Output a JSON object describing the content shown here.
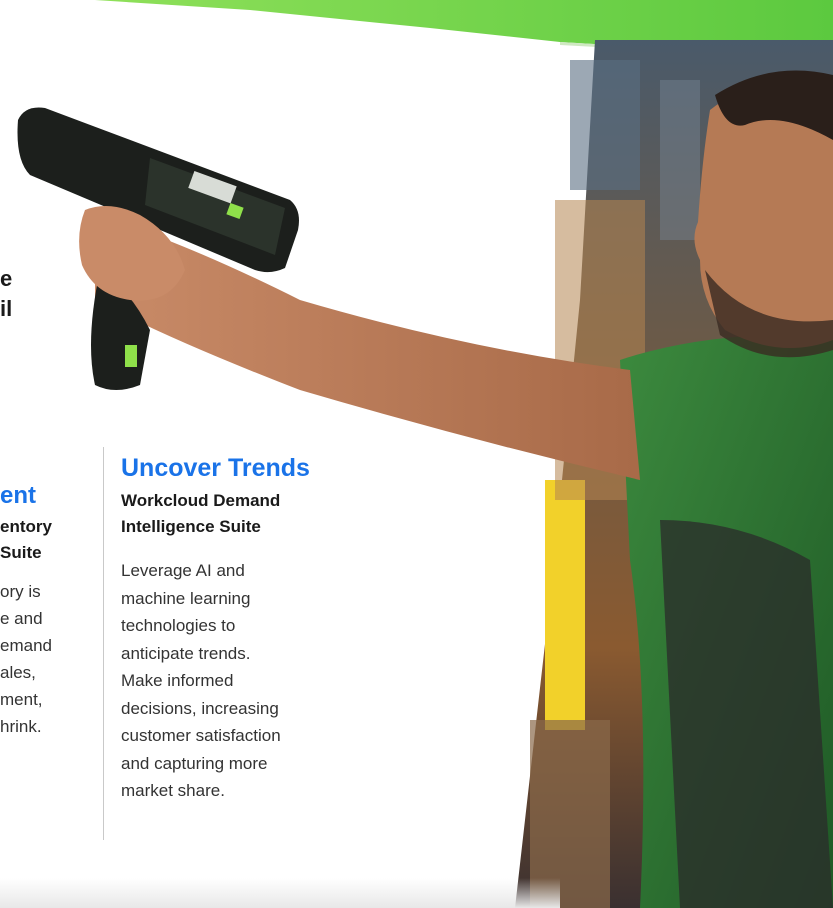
{
  "left_fragment": {
    "heading_line1": "e",
    "heading_line2": "il",
    "title": "ent",
    "subtitle_line1": "entory",
    "subtitle_line2": "Suite",
    "body_lines": [
      "ory is",
      "e and",
      "emand",
      "ales,",
      "ment,",
      "hrink."
    ]
  },
  "trends": {
    "title": "Uncover Trends",
    "subtitle_line1": "Workcloud Demand",
    "subtitle_line2": "Intelligence Suite",
    "body_lines": [
      "Leverage AI and",
      "machine learning",
      "technologies to",
      "anticipate trends.",
      "Make informed",
      "decisions, increasing",
      "customer satisfaction",
      "and capturing more",
      "market share."
    ]
  },
  "colors": {
    "accent_blue": "#1a73e8",
    "brand_green": "#7ed957",
    "shirt_green": "#2e6b34"
  },
  "icons": {
    "scanner": "handheld-scanner-icon"
  }
}
